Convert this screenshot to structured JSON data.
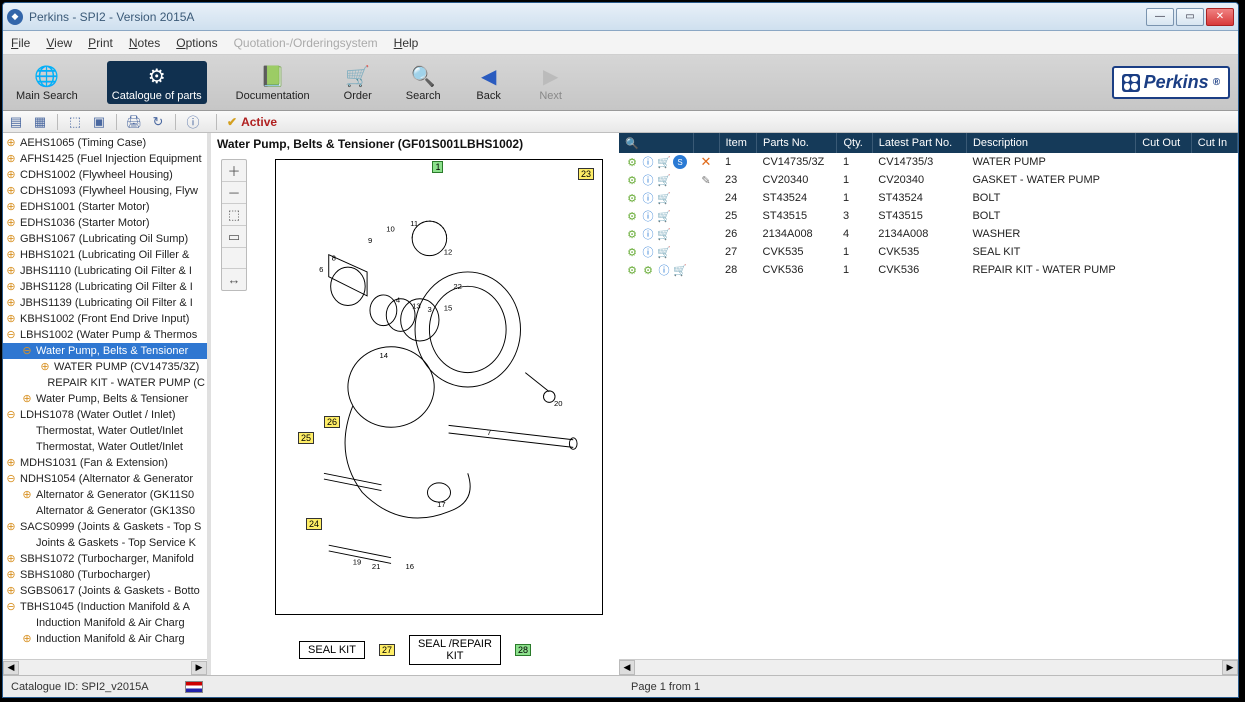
{
  "window": {
    "title": "Perkins - SPI2  - Version 2015A"
  },
  "menu": {
    "file": "File",
    "view": "View",
    "print": "Print",
    "notes": "Notes",
    "options": "Options",
    "quotation": "Quotation-/Orderingsystem",
    "help": "Help"
  },
  "toolbar": {
    "main_search": "Main Search",
    "catalogue": "Catalogue of parts",
    "documentation": "Documentation",
    "order": "Order",
    "search": "Search",
    "back": "Back",
    "next": "Next"
  },
  "brand": "Perkins",
  "active_label": "Active",
  "tree": [
    {
      "l": 0,
      "exp": "plus",
      "text": "AEHS1065 (Timing Case)"
    },
    {
      "l": 0,
      "exp": "plus",
      "text": "AFHS1425 (Fuel Injection Equipment"
    },
    {
      "l": 0,
      "exp": "plus",
      "text": "CDHS1002 (Flywheel Housing)"
    },
    {
      "l": 0,
      "exp": "plus",
      "text": "CDHS1093 (Flywheel Housing, Flyw"
    },
    {
      "l": 0,
      "exp": "plus",
      "text": "EDHS1001 (Starter Motor)"
    },
    {
      "l": 0,
      "exp": "plus",
      "text": "EDHS1036 (Starter Motor)"
    },
    {
      "l": 0,
      "exp": "plus",
      "text": "GBHS1067 (Lubricating Oil Sump)"
    },
    {
      "l": 0,
      "exp": "plus",
      "text": "HBHS1021 (Lubricating Oil Filler &"
    },
    {
      "l": 0,
      "exp": "plus",
      "text": "JBHS1110 (Lubricating Oil Filter & I"
    },
    {
      "l": 0,
      "exp": "plus",
      "text": "JBHS1128 (Lubricating Oil Filter & I"
    },
    {
      "l": 0,
      "exp": "plus",
      "text": "JBHS1139 (Lubricating Oil Filter & I"
    },
    {
      "l": 0,
      "exp": "plus",
      "text": "KBHS1002 (Front End Drive Input)"
    },
    {
      "l": 0,
      "exp": "minus",
      "text": "LBHS1002 (Water Pump & Thermos"
    },
    {
      "l": 1,
      "exp": "minus",
      "text": "Water Pump, Belts & Tensioner",
      "sel": true
    },
    {
      "l": 2,
      "exp": "plus",
      "text": "WATER PUMP (CV14735/3Z)"
    },
    {
      "l": 2,
      "exp": "blank",
      "text": "REPAIR KIT - WATER PUMP (C"
    },
    {
      "l": 1,
      "exp": "plus",
      "text": "Water Pump, Belts & Tensioner"
    },
    {
      "l": 0,
      "exp": "minus",
      "text": "LDHS1078 (Water Outlet / Inlet)"
    },
    {
      "l": 1,
      "exp": "blank",
      "text": "Thermostat, Water Outlet/Inlet"
    },
    {
      "l": 1,
      "exp": "blank",
      "text": "Thermostat, Water Outlet/Inlet"
    },
    {
      "l": 0,
      "exp": "plus",
      "text": "MDHS1031 (Fan & Extension)"
    },
    {
      "l": 0,
      "exp": "minus",
      "text": "NDHS1054 (Alternator & Generator"
    },
    {
      "l": 1,
      "exp": "plus",
      "text": "Alternator & Generator (GK11S0"
    },
    {
      "l": 1,
      "exp": "blank",
      "text": "Alternator & Generator (GK13S0"
    },
    {
      "l": 0,
      "exp": "plus",
      "text": "SACS0999 (Joints & Gaskets - Top S"
    },
    {
      "l": 1,
      "exp": "blank",
      "text": "Joints & Gaskets - Top Service K"
    },
    {
      "l": 0,
      "exp": "plus",
      "text": "SBHS1072 (Turbocharger, Manifold"
    },
    {
      "l": 0,
      "exp": "plus",
      "text": "SBHS1080 (Turbocharger)"
    },
    {
      "l": 0,
      "exp": "plus",
      "text": "SGBS0617 (Joints & Gaskets - Botto"
    },
    {
      "l": 0,
      "exp": "minus",
      "text": "TBHS1045 (Induction Manifold & A"
    },
    {
      "l": 1,
      "exp": "blank",
      "text": "Induction Manifold & Air Charg"
    },
    {
      "l": 1,
      "exp": "plus",
      "text": "Induction Manifold & Air Charg"
    }
  ],
  "center_title": "Water Pump, Belts & Tensioner (GF01S001LBHS1002)",
  "callouts": {
    "c1": "1",
    "c23": "23",
    "c24": "24",
    "c25": "25",
    "c26": "26",
    "c27": "27",
    "c28": "28"
  },
  "kit": {
    "seal": "SEAL KIT",
    "repair": "SEAL /REPAIR\nKIT"
  },
  "table": {
    "headers": {
      "item": "Item",
      "parts": "Parts No.",
      "qty": "Qty.",
      "latest": "Latest Part No.",
      "desc": "Description",
      "cutout": "Cut Out",
      "cutin": "Cut In"
    },
    "rows": [
      {
        "icons": "full",
        "item": "1",
        "parts": "CV14735/3Z",
        "qty": "1",
        "latest": "CV14735/3",
        "desc": "WATER PUMP"
      },
      {
        "icons": "note",
        "item": "23",
        "parts": "CV20340",
        "qty": "1",
        "latest": "CV20340",
        "desc": "GASKET - WATER PUMP"
      },
      {
        "icons": "std",
        "item": "24",
        "parts": "ST43524",
        "qty": "1",
        "latest": "ST43524",
        "desc": "BOLT"
      },
      {
        "icons": "std",
        "item": "25",
        "parts": "ST43515",
        "qty": "3",
        "latest": "ST43515",
        "desc": "BOLT"
      },
      {
        "icons": "std",
        "item": "26",
        "parts": "2134A008",
        "qty": "4",
        "latest": "2134A008",
        "desc": "WASHER"
      },
      {
        "icons": "std",
        "item": "27",
        "parts": "CVK535",
        "qty": "1",
        "latest": "CVK535",
        "desc": "SEAL KIT"
      },
      {
        "icons": "std2",
        "item": "28",
        "parts": "CVK536",
        "qty": "1",
        "latest": "CVK536",
        "desc": "REPAIR KIT - WATER PUMP"
      }
    ]
  },
  "status": {
    "catalogue": "Catalogue ID: SPI2_v2015A",
    "page": "Page 1 from 1"
  }
}
